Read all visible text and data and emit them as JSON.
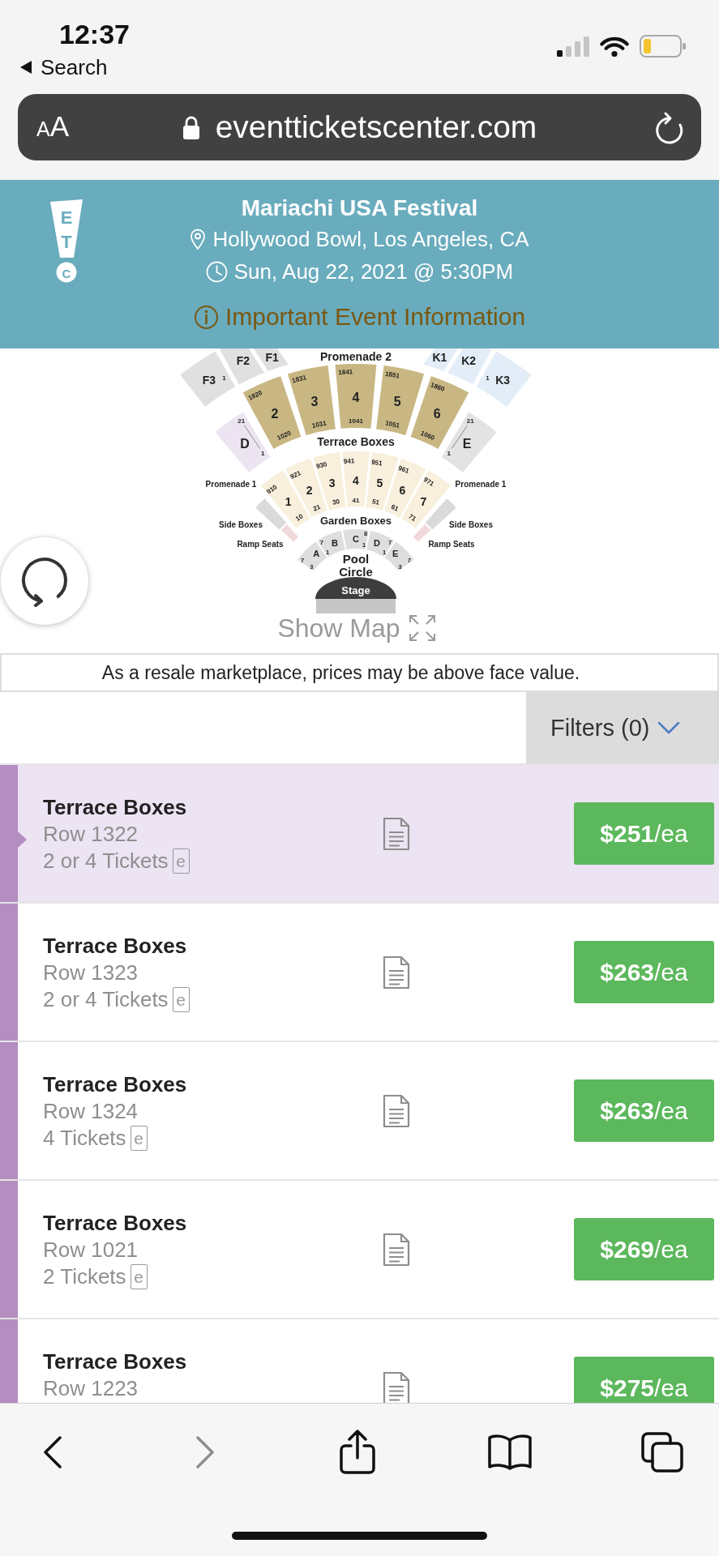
{
  "status_bar": {
    "time": "12:37",
    "back_link": "Search"
  },
  "address_bar": {
    "text_size_letters": [
      "A",
      "A"
    ],
    "url": "eventticketscenter.com"
  },
  "event_header": {
    "logo_letters": [
      "E",
      "T",
      "C"
    ],
    "title": "Mariachi USA Festival",
    "venue": "Hollywood Bowl, Los Angeles, CA",
    "date": "Sun, Aug 22, 2021 @ 5:30PM",
    "info_link": "Important Event Information"
  },
  "seat_map": {
    "upper_left": [
      {
        "label": "F1"
      },
      {
        "label": "F2"
      },
      {
        "label": "F3",
        "row_mark": "1"
      }
    ],
    "upper_label": "Promenade 2",
    "upper_right": [
      {
        "label": "K1"
      },
      {
        "label": "K2"
      },
      {
        "label": "K3",
        "row_mark": "1"
      }
    ],
    "terrace_sections": [
      {
        "label": "2",
        "top_row": "1820",
        "bottom_row": "1020"
      },
      {
        "label": "3",
        "top_row": "1831",
        "bottom_row": "1031"
      },
      {
        "label": "4",
        "top_row": "1841",
        "bottom_row": "1041"
      },
      {
        "label": "5",
        "top_row": "1851",
        "bottom_row": "1051"
      },
      {
        "label": "6",
        "top_row": "1860",
        "bottom_row": "1060"
      }
    ],
    "terrace_label": "Terrace Boxes",
    "wing_sections": [
      {
        "label": "D",
        "top_row": "21",
        "bottom_row": "1",
        "color": "#ece4f0"
      },
      {
        "label": "E",
        "top_row": "21",
        "bottom_row": "1",
        "color": "#e3e3e3"
      }
    ],
    "promenade_1_labels": [
      "Promenade 1",
      "Promenade 1"
    ],
    "garden_sections": [
      {
        "label": "1",
        "outer_row": "910",
        "inner_row": "10"
      },
      {
        "label": "2",
        "outer_row": "921",
        "inner_row": "21"
      },
      {
        "label": "3",
        "outer_row": "930",
        "inner_row": "30"
      },
      {
        "label": "4",
        "outer_row": "941",
        "inner_row": "41"
      },
      {
        "label": "5",
        "outer_row": "951",
        "inner_row": "51"
      },
      {
        "label": "6",
        "outer_row": "961",
        "inner_row": "61"
      },
      {
        "label": "7",
        "outer_row": "971",
        "inner_row": "71"
      }
    ],
    "garden_label": "Garden Boxes",
    "side_boxes_labels": [
      "Side Boxes",
      "Side Boxes"
    ],
    "ramp_seats_labels": [
      "Ramp Seats",
      "Ramp Seats"
    ],
    "pool_sections": [
      {
        "label": "A",
        "marks": [
          "7",
          "3"
        ]
      },
      {
        "label": "B",
        "marks": [
          "7",
          "1"
        ]
      },
      {
        "label": "C",
        "marks": [
          "8",
          "1"
        ]
      },
      {
        "label": "D",
        "marks": [
          "7",
          "1"
        ]
      },
      {
        "label": "E",
        "marks": [
          "7",
          "3"
        ]
      }
    ],
    "pool_label_lines": [
      "Pool",
      "Circle"
    ],
    "stage_label": "Stage"
  },
  "show_map": "Show Map",
  "disclaimer": "As a resale marketplace, prices may be above face value.",
  "filters_button": "Filters (0)",
  "listings": [
    {
      "section": "Terrace Boxes",
      "row": "Row 1322",
      "quantity": "2 or 4 Tickets",
      "eticket_mark": "e",
      "price": "**$251**/ea",
      "selected": true
    },
    {
      "section": "Terrace Boxes",
      "row": "Row 1323",
      "quantity": "2 or 4 Tickets",
      "eticket_mark": "e",
      "price": "**$263**/ea",
      "selected": false
    },
    {
      "section": "Terrace Boxes",
      "row": "Row 1324",
      "quantity": "4 Tickets",
      "eticket_mark": "e",
      "price": "**$263**/ea",
      "selected": false
    },
    {
      "section": "Terrace Boxes",
      "row": "Row 1021",
      "quantity": "2 Tickets",
      "eticket_mark": "e",
      "price": "**$269**/ea",
      "selected": false
    },
    {
      "section": "Terrace Boxes",
      "row": "Row 1223",
      "price": "**$275**/ea",
      "selected": false
    }
  ],
  "toolbar": [
    {
      "kind": "back",
      "disabled": false
    },
    {
      "kind": "forward",
      "disabled": true
    },
    {
      "kind": "share",
      "disabled": false
    },
    {
      "kind": "bookmarks",
      "disabled": false
    },
    {
      "kind": "tabs",
      "disabled": false
    }
  ]
}
